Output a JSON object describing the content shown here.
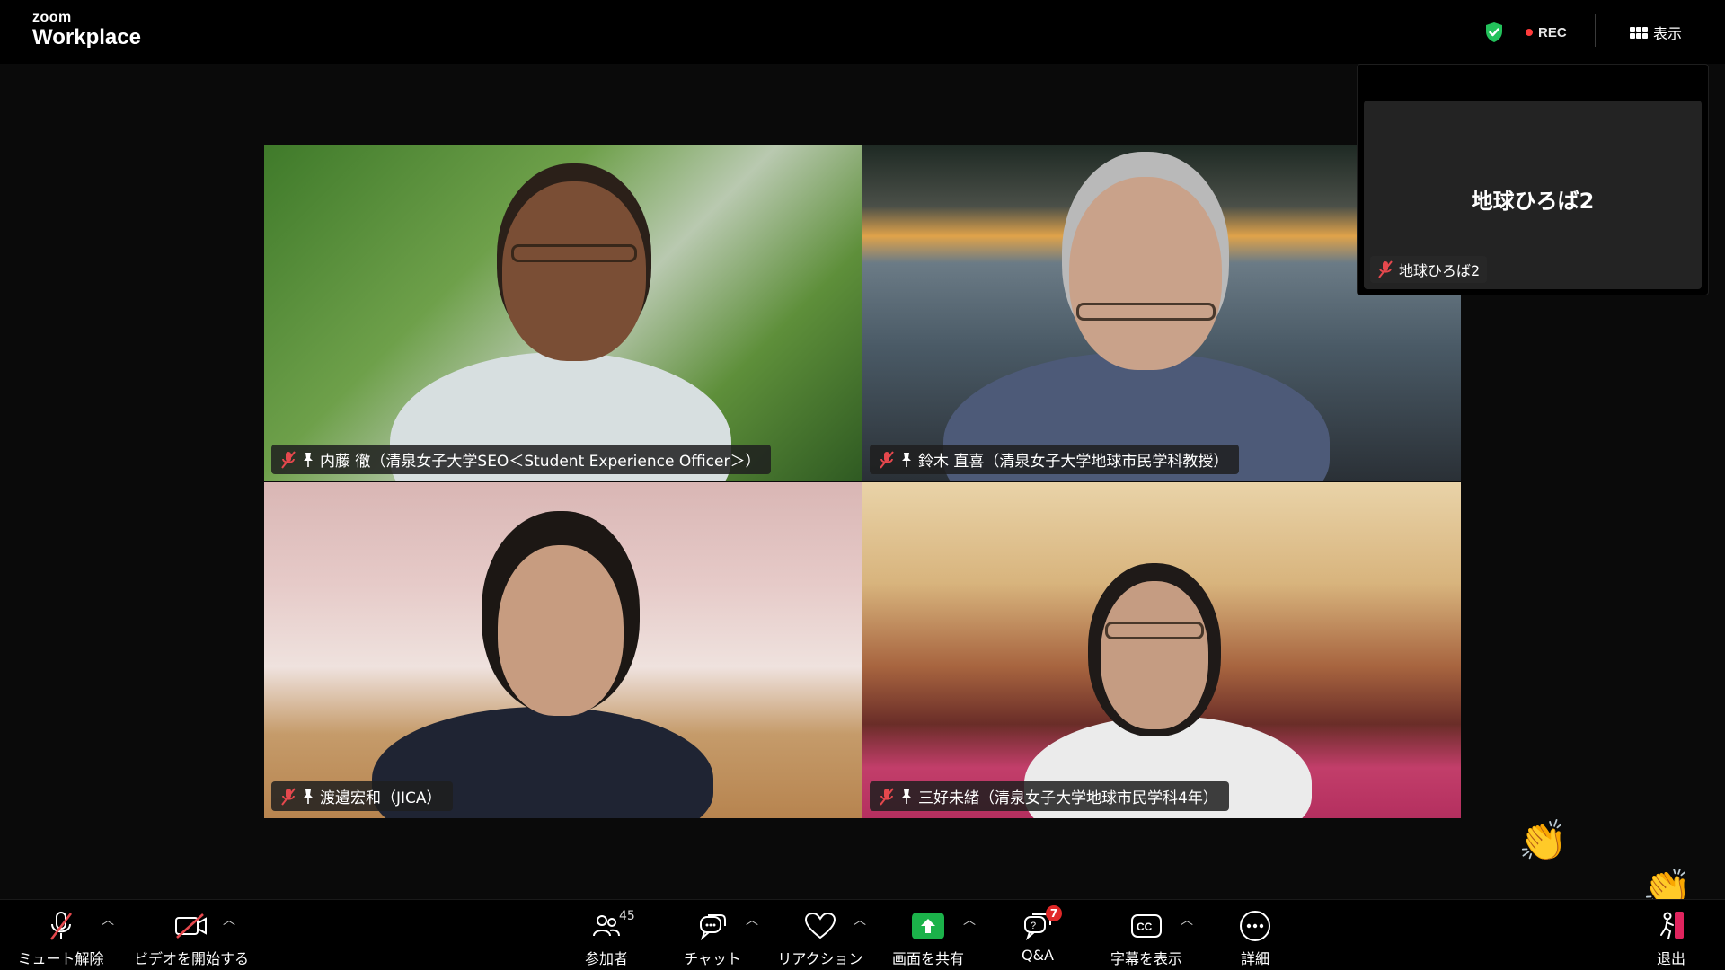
{
  "app": {
    "logo_line1": "zoom",
    "logo_line2": "Workplace"
  },
  "topbar": {
    "rec_label": "REC",
    "view_label": "表示",
    "security_color": "#23c15b"
  },
  "participants": [
    {
      "name": "内藤 徹（清泉女子大学SEO＜Student Experience Officer＞）",
      "muted": true,
      "pinned": true
    },
    {
      "name": "鈴木 直喜（清泉女子大学地球市民学科教授）",
      "muted": true,
      "pinned": true
    },
    {
      "name": "渡邉宏和（JICA）",
      "muted": true,
      "pinned": true
    },
    {
      "name": "三好未緒（清泉女子大学地球市民学科4年）",
      "muted": true,
      "pinned": true
    }
  ],
  "self_view": {
    "display_name": "地球ひろば2",
    "tag_name": "地球ひろば2",
    "muted": true
  },
  "reactions": [
    "clap-emoji",
    "clap-emoji"
  ],
  "toolbar": {
    "unmute_label": "ミュート解除",
    "start_video_label": "ビデオを開始する",
    "participants_label": "参加者",
    "participants_count": "45",
    "chat_label": "チャット",
    "reactions_label": "リアクション",
    "share_label": "画面を共有",
    "qa_label": "Q&A",
    "qa_badge": "7",
    "captions_label": "字幕を表示",
    "more_label": "詳細",
    "leave_label": "退出",
    "share_color": "#1bb24a",
    "leave_color": "#e0245e"
  }
}
